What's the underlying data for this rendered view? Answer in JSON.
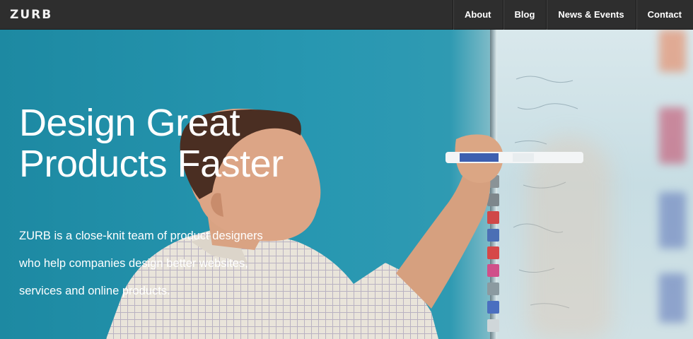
{
  "header": {
    "logo": "ZURB",
    "nav": [
      {
        "label": "About"
      },
      {
        "label": "Blog"
      },
      {
        "label": "News & Events"
      },
      {
        "label": "Contact"
      }
    ]
  },
  "hero": {
    "headline_lines": [
      "Design Great",
      "Products Faster"
    ],
    "tagline_lines": [
      "ZURB is a close-knit team of product designers",
      "who help companies design better websites,",
      "services and online products."
    ],
    "image": "man-writing-on-whiteboard-photo"
  },
  "colors": {
    "nav_background": "#2e2e2e",
    "hero_background": "#1e8aa3",
    "text": "#ffffff"
  }
}
